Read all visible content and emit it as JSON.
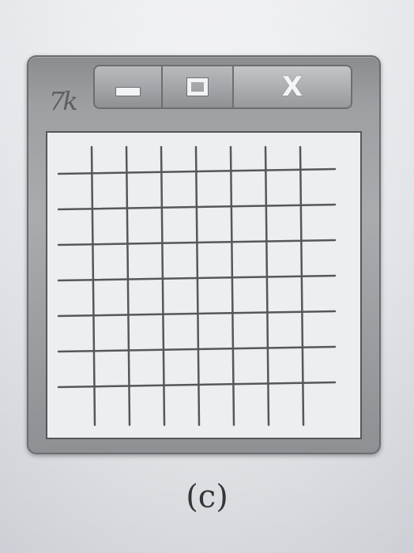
{
  "window": {
    "app_icon_text": "7k",
    "buttons": {
      "minimize": "minimize",
      "maximize": "maximize",
      "close_label": "X"
    },
    "grid": {
      "rows": 7,
      "columns": 7,
      "line_color": "#55575b"
    }
  },
  "caption": "(c)",
  "colors": {
    "frame": "#9d9fa3",
    "client_background": "#eceef0",
    "page_background": "#e6e8ec"
  }
}
